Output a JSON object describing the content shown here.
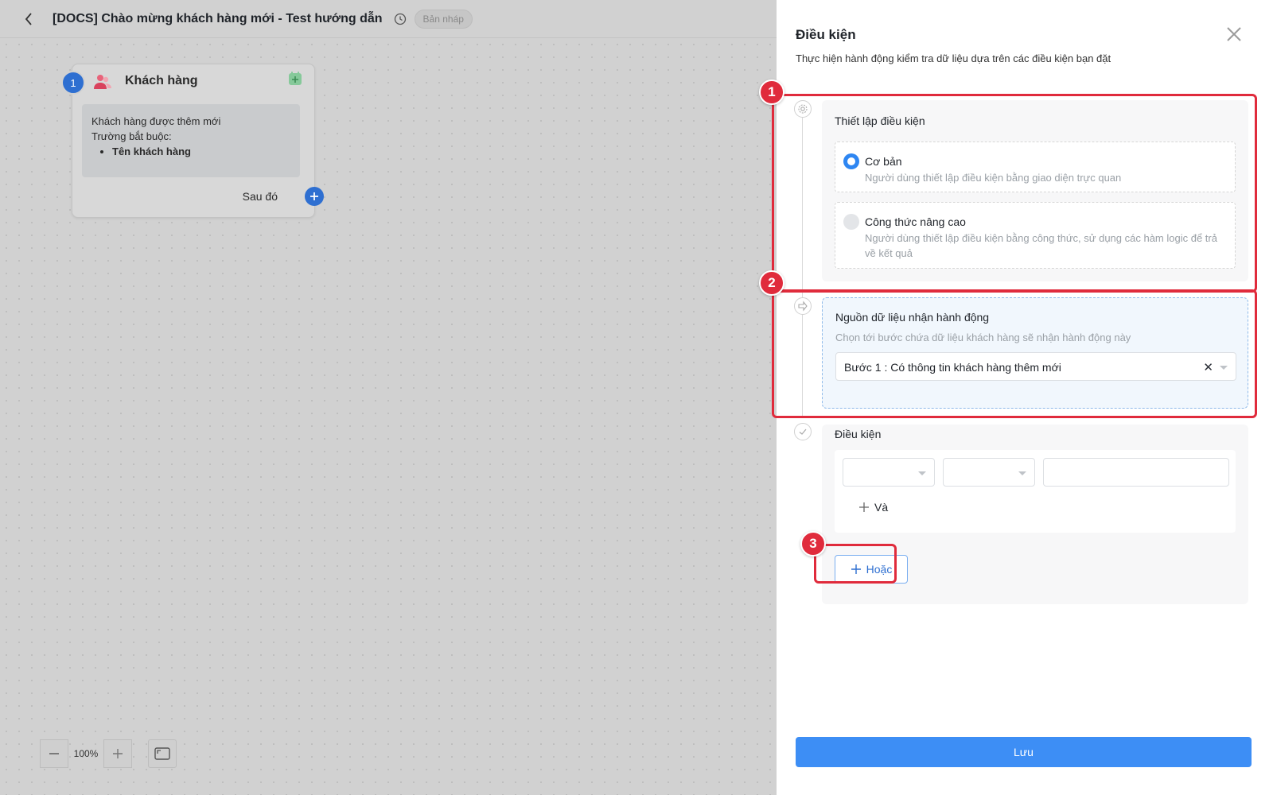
{
  "header": {
    "title": "[DOCS] Chào mừng khách hàng mới - Test hướng dẫn",
    "status_badge": "Bản nháp"
  },
  "node": {
    "step": "1",
    "title": "Khách hàng",
    "event": "Khách hàng được thêm mới",
    "required_label": "Trường bắt buộc:",
    "required_fields": [
      "Tên khách hàng"
    ],
    "next_label": "Sau đó"
  },
  "zoom": {
    "value": "100%"
  },
  "panel": {
    "title": "Điều kiện",
    "description": "Thực hiện hành động kiểm tra dữ liệu dựa trên các điều kiện bạn đặt",
    "setup": {
      "heading": "Thiết lập điều kiện",
      "options": [
        {
          "label": "Cơ bản",
          "desc": "Người dùng thiết lập điều kiện bằng giao diện trực quan",
          "selected": true
        },
        {
          "label": "Công thức nâng cao",
          "desc": "Người dùng thiết lập điều kiện bằng công thức, sử dụng các hàm logic để trả về kết quả",
          "selected": false
        }
      ]
    },
    "source": {
      "heading": "Nguồn dữ liệu nhận hành động",
      "desc": "Chọn tới bước chứa dữ liệu khách hàng sẽ nhận hành động này",
      "selected": "Bước 1 : Có thông tin khách hàng thêm mới"
    },
    "conditions": {
      "heading": "Điều kiện",
      "and_label": "Và",
      "or_label": "Hoặc"
    },
    "save_label": "Lưu"
  },
  "annotations": [
    "1",
    "2",
    "3"
  ],
  "colors": {
    "primary": "#3d8ef5",
    "annotation": "#e02b3c",
    "canvas": "#d1d1d1"
  }
}
